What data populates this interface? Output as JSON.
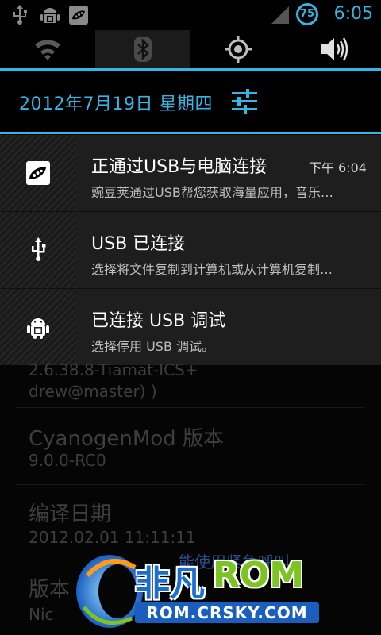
{
  "status_bar": {
    "time": "6:05",
    "battery_level": "75",
    "left_icons": [
      "usb-icon",
      "android-debug-icon",
      "wandoujia-icon"
    ],
    "right_icons": [
      "signal-icon",
      "battery-icon"
    ]
  },
  "quick_toggles": [
    {
      "name": "wifi-toggle",
      "icon": "wifi-icon",
      "active": false
    },
    {
      "name": "bluetooth-toggle",
      "icon": "bluetooth-icon",
      "active": true
    },
    {
      "name": "gps-toggle",
      "icon": "gps-icon",
      "active": false
    },
    {
      "name": "sound-toggle",
      "icon": "volume-icon",
      "active": false
    }
  ],
  "header": {
    "date": "2012年7月19日 星期四",
    "settings_icon": "settings-sliders-icon"
  },
  "notifications": [
    {
      "icon": "wandoujia-icon",
      "title": "正通过USB与电脑连接",
      "subtitle": "豌豆荚通过USB帮您获取海量应用，音乐…",
      "time": "下午 6:04"
    },
    {
      "icon": "usb-icon",
      "title": "USB 已连接",
      "subtitle": "选择将文件复制到计算机或从计算机复制…",
      "time": ""
    },
    {
      "icon": "android-debug-icon",
      "title": "已连接 USB 调试",
      "subtitle": "选择停用 USB 调试。",
      "time": ""
    }
  ],
  "background_content": {
    "kernel_line1": "2.6.38.8-Tiamat-ICS+",
    "kernel_line2": "drew@master) )",
    "cm_label": "CyanogenMod 版本",
    "cm_value": "9.0.0-RC0",
    "build_label": "编译日期",
    "build_value": "2012.02.01  11:11:11",
    "emergency": "能使用紧急呼叫",
    "version_label": "版本",
    "nic": "Nic"
  },
  "watermark": {
    "brand_cn": "非凡",
    "brand_en": "ROM",
    "url": "ROM.CRSKY.COM",
    "colors": {
      "green": "#7cc520",
      "blue": "#1a6fd0"
    }
  },
  "colors": {
    "accent": "#33b5e5"
  }
}
